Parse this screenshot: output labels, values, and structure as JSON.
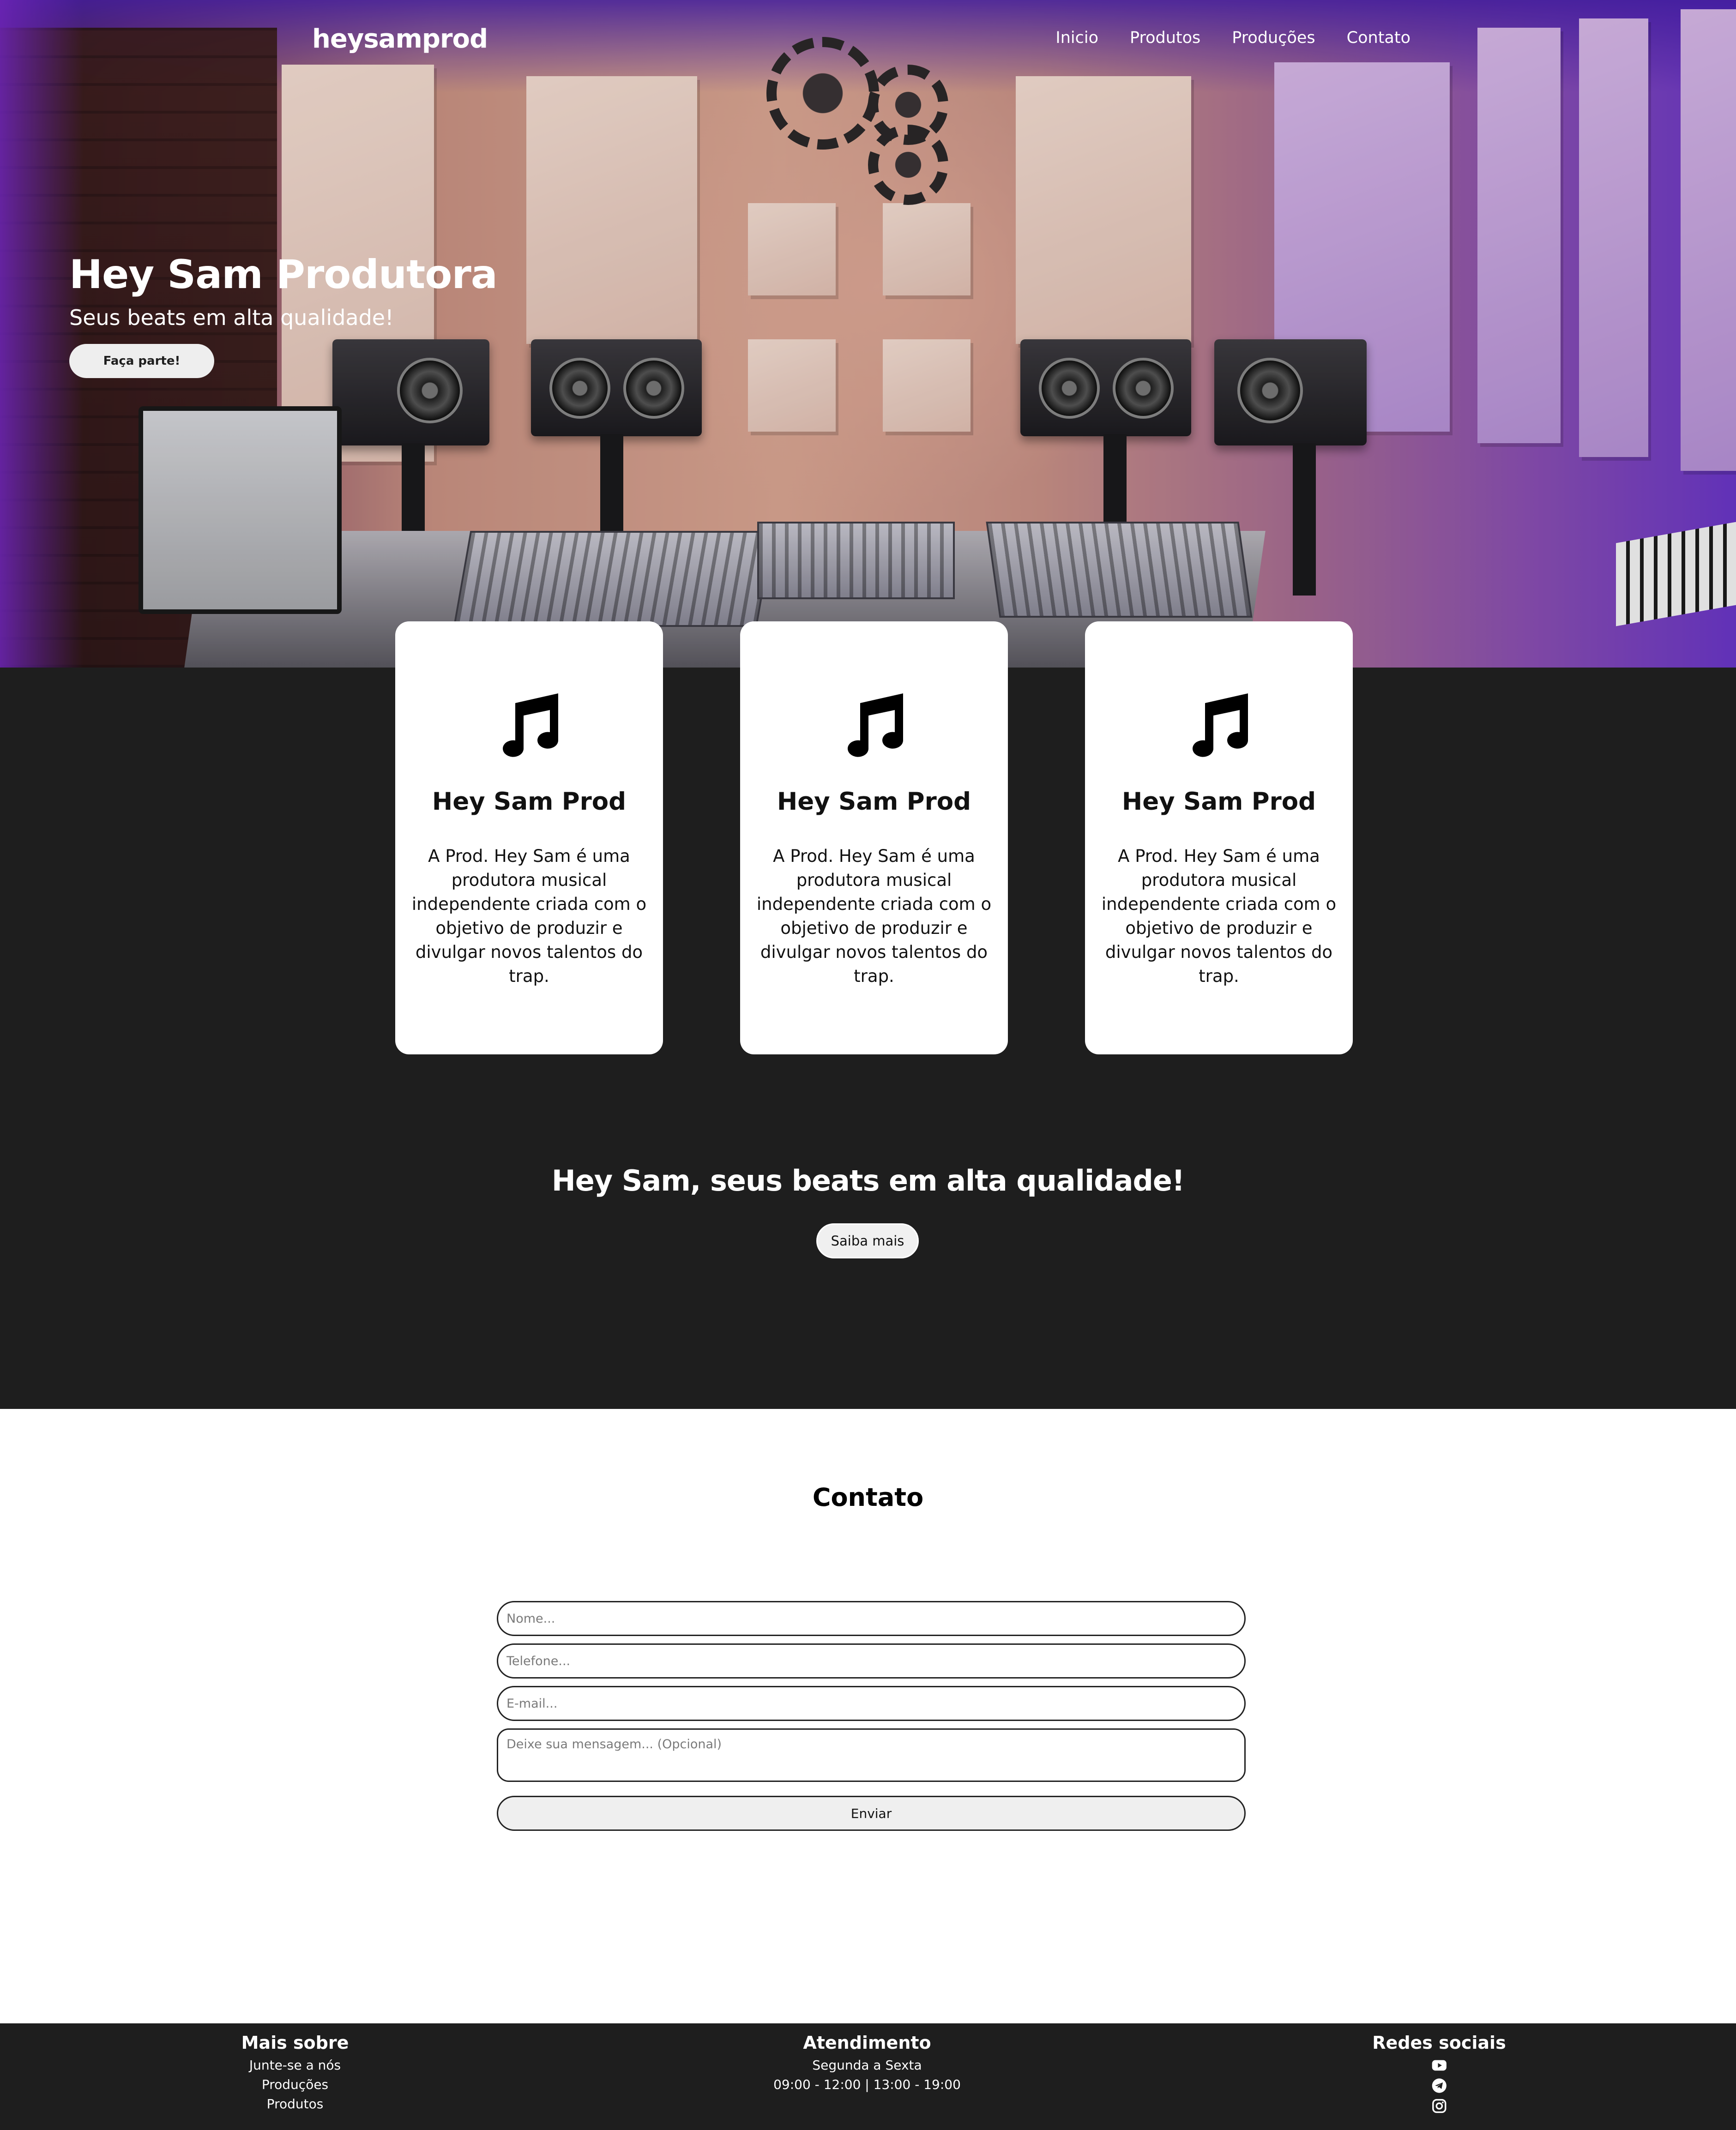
{
  "nav": {
    "brand": "heysamprod",
    "links": [
      "Inicio",
      "Produtos",
      "Produções",
      "Contato"
    ]
  },
  "hero": {
    "title": "Hey Sam Produtora",
    "subtitle": "Seus beats em alta qualidade!",
    "button": "Faça parte!"
  },
  "cards": [
    {
      "icon": "music-note-icon",
      "title": "Hey Sam Prod",
      "text": "A Prod. Hey Sam é uma produtora musical independente criada com o objetivo de produzir e divulgar novos talentos do trap."
    },
    {
      "icon": "music-note-icon",
      "title": "Hey Sam Prod",
      "text": "A Prod. Hey Sam é uma produtora musical independente criada com o objetivo de produzir e divulgar novos talentos do trap."
    },
    {
      "icon": "music-note-icon",
      "title": "Hey Sam Prod",
      "text": "A Prod. Hey Sam é uma produtora musical independente criada com o objetivo de produzir e divulgar novos talentos do trap."
    }
  ],
  "banner": {
    "tagline": "Hey Sam, seus beats em alta qualidade!",
    "button": "Saiba mais"
  },
  "contact": {
    "title": "Contato",
    "name_placeholder": "Nome...",
    "phone_placeholder": "Telefone...",
    "email_placeholder": "E-mail...",
    "message_placeholder": "Deixe sua mensagem... (Opcional)",
    "submit": "Enviar"
  },
  "footer": {
    "more": {
      "title": "Mais sobre",
      "items": [
        "Junte-se a nós",
        "Produções",
        "Produtos"
      ]
    },
    "service": {
      "title": "Atendimento",
      "days": "Segunda a Sexta",
      "hours": "09:00 - 12:00 | 13:00 - 19:00"
    },
    "social": {
      "title": "Redes sociais",
      "icons": [
        "youtube-icon",
        "telegram-icon",
        "instagram-icon"
      ]
    }
  },
  "colors": {
    "dark_bg": "#1e1e1e",
    "hero_purple": "#6a36c8",
    "button_light": "#eeeeee"
  }
}
